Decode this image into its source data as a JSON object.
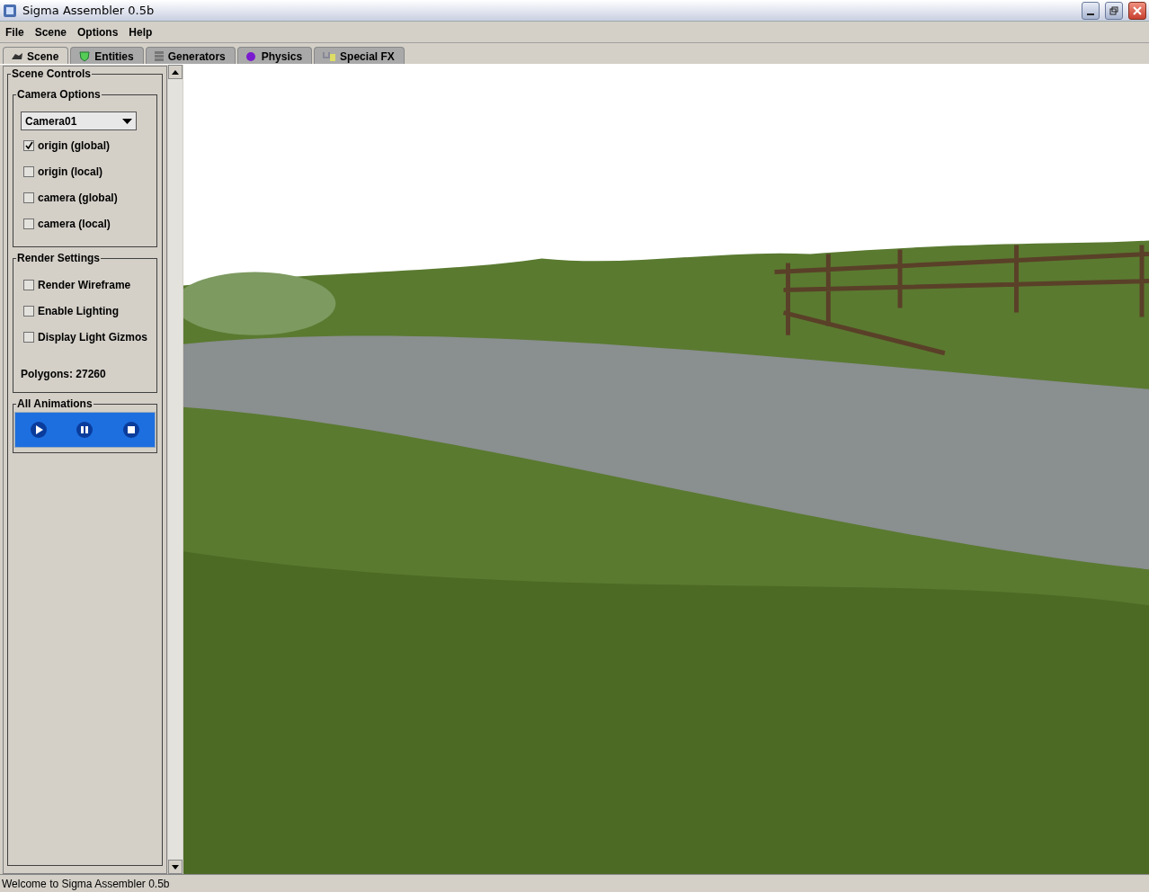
{
  "window": {
    "title": "Sigma Assembler 0.5b"
  },
  "menu": [
    "File",
    "Scene",
    "Options",
    "Help"
  ],
  "tabs": [
    {
      "label": "Scene",
      "selected": true
    },
    {
      "label": "Entities",
      "selected": false
    },
    {
      "label": "Generators",
      "selected": false
    },
    {
      "label": "Physics",
      "selected": false
    },
    {
      "label": "Special FX",
      "selected": false
    }
  ],
  "panel": {
    "title": "Scene Controls",
    "camera_options": {
      "title": "Camera Options",
      "camera": "Camera01",
      "checkboxes": [
        {
          "label": "origin (global)",
          "checked": true
        },
        {
          "label": "origin (local)",
          "checked": false
        },
        {
          "label": "camera (global)",
          "checked": false
        },
        {
          "label": "camera (local)",
          "checked": false
        }
      ]
    },
    "render_settings": {
      "title": "Render Settings",
      "checkboxes": [
        {
          "label": "Render Wireframe",
          "checked": false
        },
        {
          "label": "Enable Lighting",
          "checked": false
        },
        {
          "label": "Display Light Gizmos",
          "checked": false
        }
      ],
      "polygons": "Polygons: 27260"
    },
    "animations": {
      "title": "All Animations"
    }
  },
  "status_bar": "Welcome to Sigma Assembler 0.5b"
}
